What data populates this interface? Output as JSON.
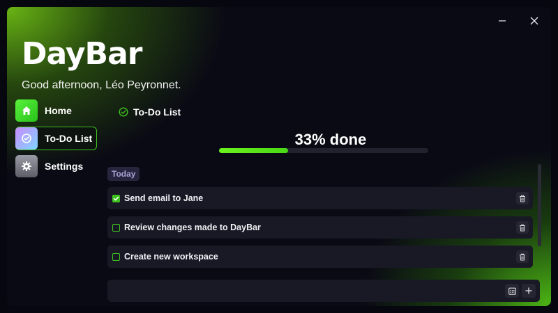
{
  "window": {
    "minimize_icon": "minimize-icon",
    "close_icon": "close-icon"
  },
  "app": {
    "title": "DayBar",
    "greeting": "Good afternoon, Léo Peyronnet."
  },
  "nav": {
    "items": [
      {
        "label": "Home",
        "icon": "home-icon",
        "active": false
      },
      {
        "label": "To-Do List",
        "icon": "check-circle-icon",
        "active": true
      },
      {
        "label": "Settings",
        "icon": "gear-icon",
        "active": false
      }
    ]
  },
  "page": {
    "header_label": "To-Do List",
    "header_icon": "check-circle-icon"
  },
  "progress": {
    "text": "33% done",
    "fraction": 0.33
  },
  "section": {
    "label": "Today"
  },
  "tasks": [
    {
      "text": "Send email to Jane",
      "done": true
    },
    {
      "text": "Review changes made to DayBar",
      "done": false
    },
    {
      "text": "Create new workspace",
      "done": false
    }
  ],
  "input": {
    "value": "",
    "placeholder": "",
    "calendar_icon": "calendar-icon",
    "add_icon": "plus-icon"
  },
  "colors": {
    "accent": "#3ec21e",
    "progress": "#5ce81a",
    "badge_bg": "#27253d",
    "card_bg": "#191926"
  }
}
